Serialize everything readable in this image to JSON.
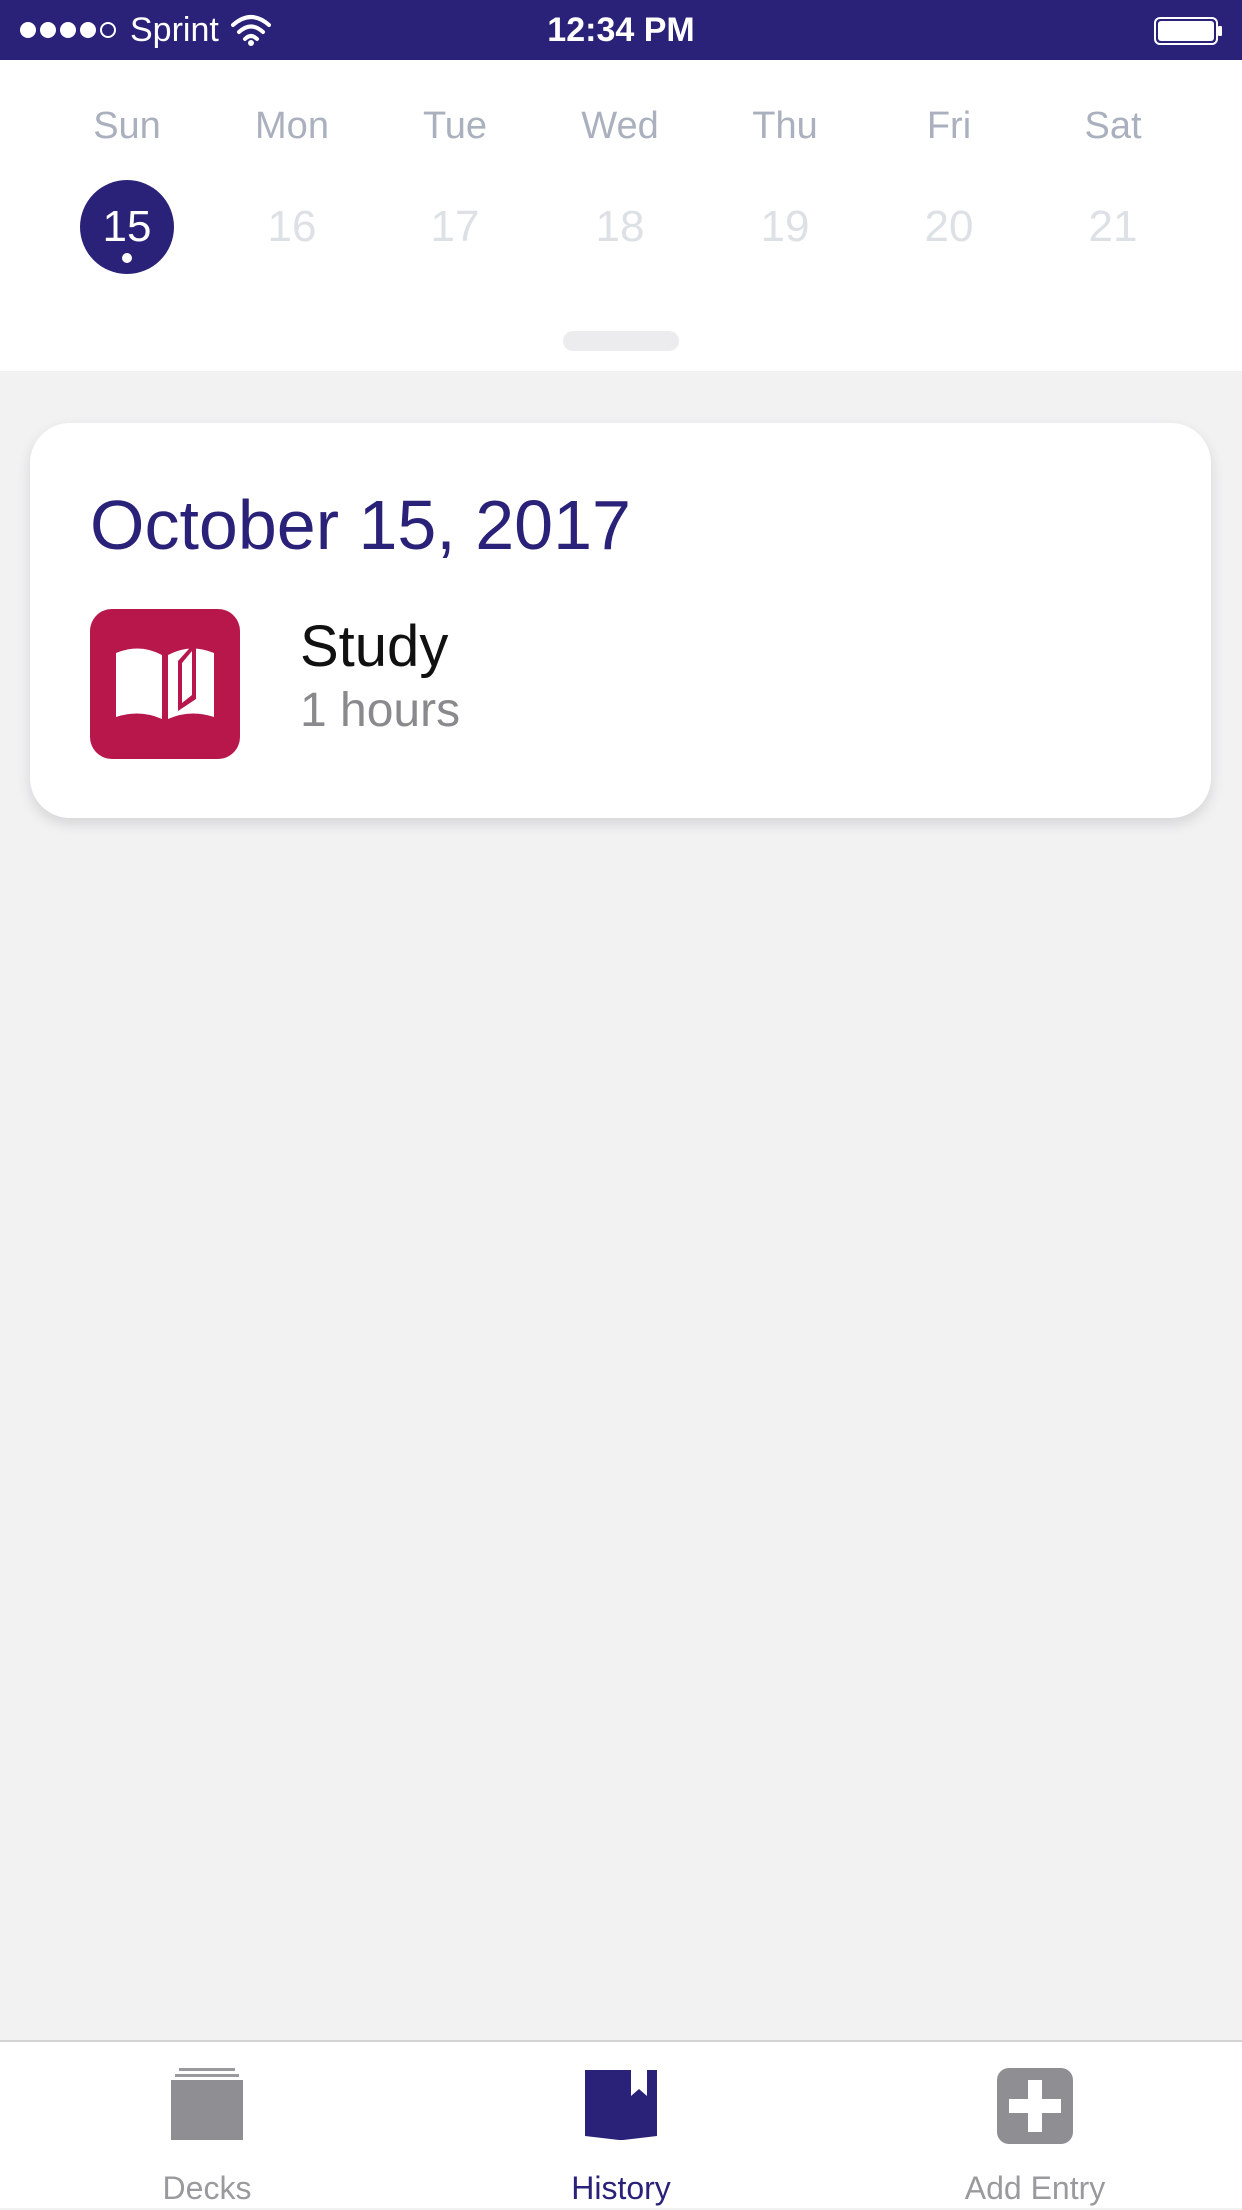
{
  "status_bar": {
    "carrier": "Sprint",
    "time": "12:34 PM",
    "signal_bars_filled": 4,
    "signal_bars_total": 5
  },
  "week": {
    "days": [
      {
        "name": "Sun",
        "date": "15",
        "selected": true,
        "has_event": true
      },
      {
        "name": "Mon",
        "date": "16",
        "selected": false,
        "has_event": false
      },
      {
        "name": "Tue",
        "date": "17",
        "selected": false,
        "has_event": false
      },
      {
        "name": "Wed",
        "date": "18",
        "selected": false,
        "has_event": false
      },
      {
        "name": "Thu",
        "date": "19",
        "selected": false,
        "has_event": false
      },
      {
        "name": "Fri",
        "date": "20",
        "selected": false,
        "has_event": false
      },
      {
        "name": "Sat",
        "date": "21",
        "selected": false,
        "has_event": false
      }
    ]
  },
  "entry": {
    "date": "October 15, 2017",
    "activity": "Study",
    "duration": "1 hours",
    "icon": "open-book-icon"
  },
  "tabs": [
    {
      "label": "Decks",
      "icon": "decks-icon",
      "active": false
    },
    {
      "label": "History",
      "icon": "history-book-icon",
      "active": true
    },
    {
      "label": "Add Entry",
      "icon": "add-entry-icon",
      "active": false
    }
  ],
  "colors": {
    "primary": "#2a2178",
    "activity": "#b7174a",
    "inactive": "#9a9a9e",
    "background": "#f2f2f3"
  }
}
